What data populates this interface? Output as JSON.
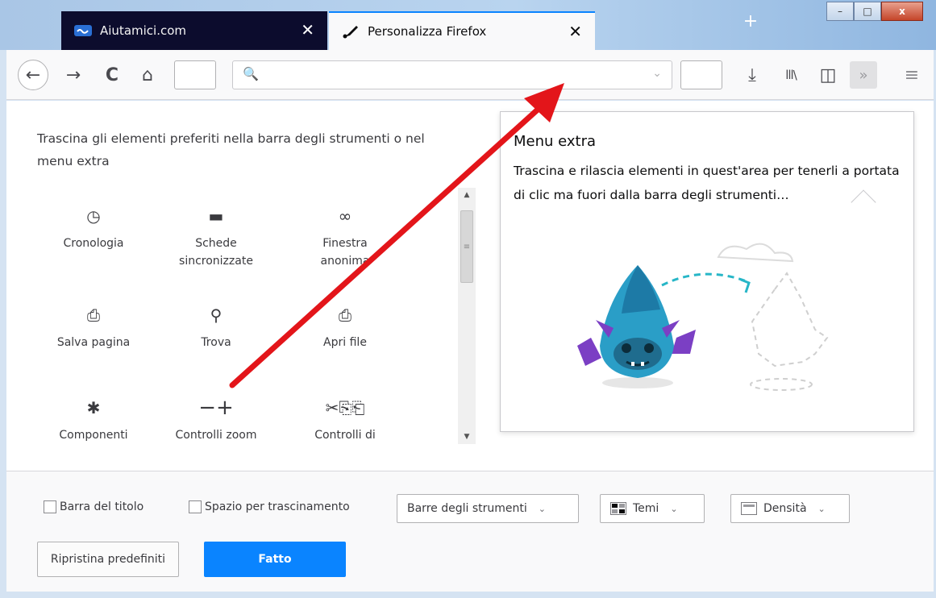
{
  "window": {
    "controls": {
      "minimize": "–",
      "maximize": "□",
      "close": "x"
    }
  },
  "tabs": [
    {
      "label": "Aiutamici.com",
      "close": "✕"
    },
    {
      "label": "Personalizza Firefox",
      "close": "✕"
    }
  ],
  "newtab_symbol": "+",
  "navbar": {
    "back": "←",
    "forward": "→",
    "reload": "C",
    "home": "⌂",
    "search_icon": "🔍",
    "dropdown": "⌄",
    "download": "⤓",
    "library": "lll\\",
    "sidebar": "◫",
    "overflow": "»",
    "menu": "≡"
  },
  "customize": {
    "intro": "Trascina gli elementi preferiti nella barra degli strumenti o nel menu extra",
    "items": [
      {
        "icon": "clock-icon",
        "label": "Cronologia"
      },
      {
        "icon": "synced-tabs-icon",
        "label": "Schede sincronizzate"
      },
      {
        "icon": "private-mask-icon",
        "label": "Finestra anonima"
      },
      {
        "icon": "save-page-icon",
        "label": "Salva pagina"
      },
      {
        "icon": "find-icon",
        "label": "Trova"
      },
      {
        "icon": "open-file-icon",
        "label": "Apri file"
      },
      {
        "icon": "puzzle-icon",
        "label": "Componenti"
      },
      {
        "icon": "zoom-icon",
        "label": "Controlli zoom"
      },
      {
        "icon": "edit-controls-icon",
        "label": "Controlli di"
      }
    ],
    "glyphs": {
      "clock": "◷",
      "synced": "▬",
      "private": "∞",
      "save": "⎙",
      "find": "⚲",
      "open": "⎙",
      "puzzle": "✱",
      "zoom": "−+",
      "edit": "✂⎘⎗"
    }
  },
  "overflow_panel": {
    "title": "Menu extra",
    "description": "Trascina e rilascia elementi in quest'area per tenerli a portata di clic ma fuori dalla barra degli strumenti…"
  },
  "footer": {
    "title_bar_label": "Barra del titolo",
    "drag_space_label": "Spazio per trascinamento",
    "toolbars_label": "Barre degli strumenti",
    "themes_label": "Temi",
    "density_label": "Densità",
    "reset_label": "Ripristina predefiniti",
    "done_label": "Fatto",
    "caret": "⌄"
  },
  "colors": {
    "accent": "#0a84ff",
    "annotation_arrow": "#e3151a",
    "dark_tab": "#0c0c2d"
  }
}
